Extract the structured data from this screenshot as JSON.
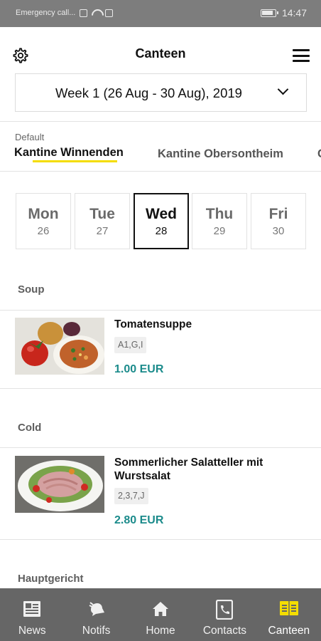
{
  "status_bar": {
    "carrier": "Emergency call...",
    "time": "14:47"
  },
  "header": {
    "title": "Canteen",
    "settings_icon": "gear-icon",
    "menu_icon": "hamburger-menu-icon"
  },
  "week_selector": {
    "label": "Week 1 (26 Aug - 30 Aug), 2019"
  },
  "canteen_tabs": {
    "default_label": "Default",
    "tabs": [
      {
        "label": "Kantine Winnenden",
        "active": true
      },
      {
        "label": "Kantine Obersontheim",
        "active": false
      },
      {
        "label": "C",
        "active": false
      }
    ],
    "accent_color": "#f4dd00"
  },
  "days": [
    {
      "name": "Mon",
      "num": "26"
    },
    {
      "name": "Tue",
      "num": "27"
    },
    {
      "name": "Wed",
      "num": "28",
      "active": true
    },
    {
      "name": "Thu",
      "num": "29"
    },
    {
      "name": "Fri",
      "num": "30"
    }
  ],
  "sections": [
    {
      "title": "Soup",
      "meals": [
        {
          "name": "Tomatensuppe",
          "allergens": "A1,G,I",
          "price": "1.00 EUR"
        }
      ]
    },
    {
      "title": "Cold",
      "meals": [
        {
          "name": "Sommerlicher Salatteller mit Wurstsalat",
          "allergens": "2,3,7,J",
          "price": "2.80 EUR"
        }
      ]
    },
    {
      "title": "Hauptgericht",
      "meals": []
    }
  ],
  "price_color": "#1b8b8b",
  "bottom_nav": [
    {
      "label": "News",
      "icon": "newspaper-icon"
    },
    {
      "label": "Notifs",
      "icon": "notification-icon"
    },
    {
      "label": "Home",
      "icon": "home-icon"
    },
    {
      "label": "Contacts",
      "icon": "phone-contacts-icon"
    },
    {
      "label": "Canteen",
      "icon": "canteen-menu-icon",
      "active": true
    }
  ]
}
